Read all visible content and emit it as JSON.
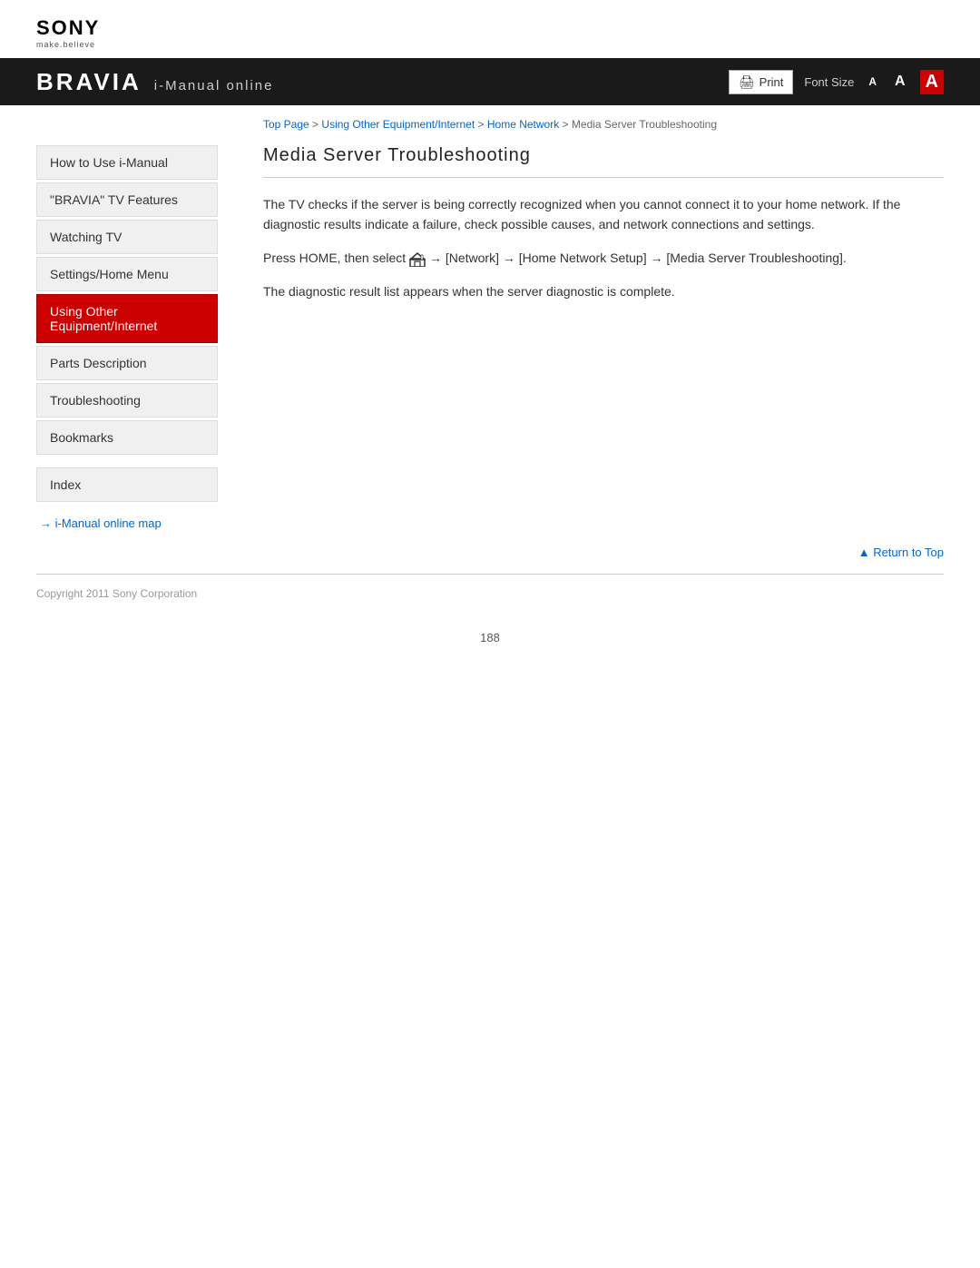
{
  "logo": {
    "brand": "SONY",
    "tagline": "make.believe"
  },
  "topbar": {
    "bravia": "BRAVIA",
    "imanual": "i-Manual online",
    "print_label": "Print",
    "font_size_label": "Font Size",
    "font_small": "A",
    "font_medium": "A",
    "font_large": "A"
  },
  "breadcrumb": {
    "top_page": "Top Page",
    "separator1": " > ",
    "using_other": "Using Other Equipment/Internet",
    "separator2": " > ",
    "home_network": "Home Network",
    "separator3": " > ",
    "current": "Media Server Troubleshooting"
  },
  "sidebar": {
    "items": [
      {
        "id": "how-to-use",
        "label": "How to Use i-Manual"
      },
      {
        "id": "bravia-tv",
        "label": "\"BRAVIA\" TV Features"
      },
      {
        "id": "watching-tv",
        "label": "Watching TV"
      },
      {
        "id": "settings-home",
        "label": "Settings/Home Menu"
      },
      {
        "id": "using-other",
        "label": "Using Other Equipment/Internet",
        "active": true
      },
      {
        "id": "parts-desc",
        "label": "Parts Description"
      },
      {
        "id": "troubleshooting",
        "label": "Troubleshooting"
      },
      {
        "id": "bookmarks",
        "label": "Bookmarks"
      }
    ],
    "index_label": "Index",
    "map_link": "i-Manual online map"
  },
  "content": {
    "page_title": "Media Server Troubleshooting",
    "paragraph1": "The TV checks if the server is being correctly recognized when you cannot connect it to your home network. If the diagnostic results indicate a failure, check possible causes, and network connections and settings.",
    "paragraph2_pre": "Press HOME, then select ",
    "paragraph2_mid": " → [Network] → [Home Network Setup] → [Media Server Troubleshooting].",
    "paragraph3": "The diagnostic result list appears when the server diagnostic is complete."
  },
  "return_top": "Return to Top",
  "footer": {
    "copyright": "Copyright 2011 Sony Corporation"
  },
  "page_number": "188"
}
